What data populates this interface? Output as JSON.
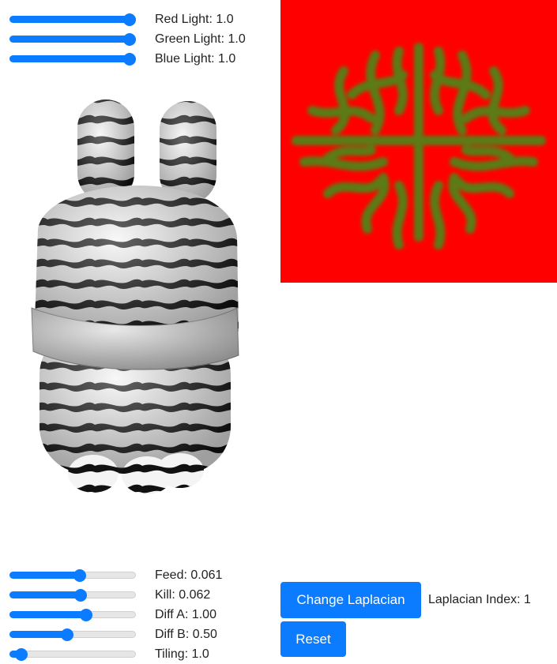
{
  "light_sliders": [
    {
      "label": "Red Light: 1.0",
      "fraction": 1.0
    },
    {
      "label": "Green Light: 1.0",
      "fraction": 1.0
    },
    {
      "label": "Blue Light: 1.0",
      "fraction": 1.0
    }
  ],
  "param_sliders": [
    {
      "label": "Feed: 0.061",
      "fraction": 0.56
    },
    {
      "label": "Kill: 0.062",
      "fraction": 0.57
    },
    {
      "label": "Diff A: 1.00",
      "fraction": 0.62
    },
    {
      "label": "Diff B: 0.50",
      "fraction": 0.45
    },
    {
      "label": "Tiling: 1.0",
      "fraction": 0.05
    }
  ],
  "buttons": {
    "change_laplacian": "Change Laplacian",
    "reset": "Reset"
  },
  "laplacian_index_label": "Laplacian Index: 1",
  "colors": {
    "accent": "#0b7bff",
    "rd_background": "#ff0000",
    "rd_pattern": "#5c7a14"
  }
}
